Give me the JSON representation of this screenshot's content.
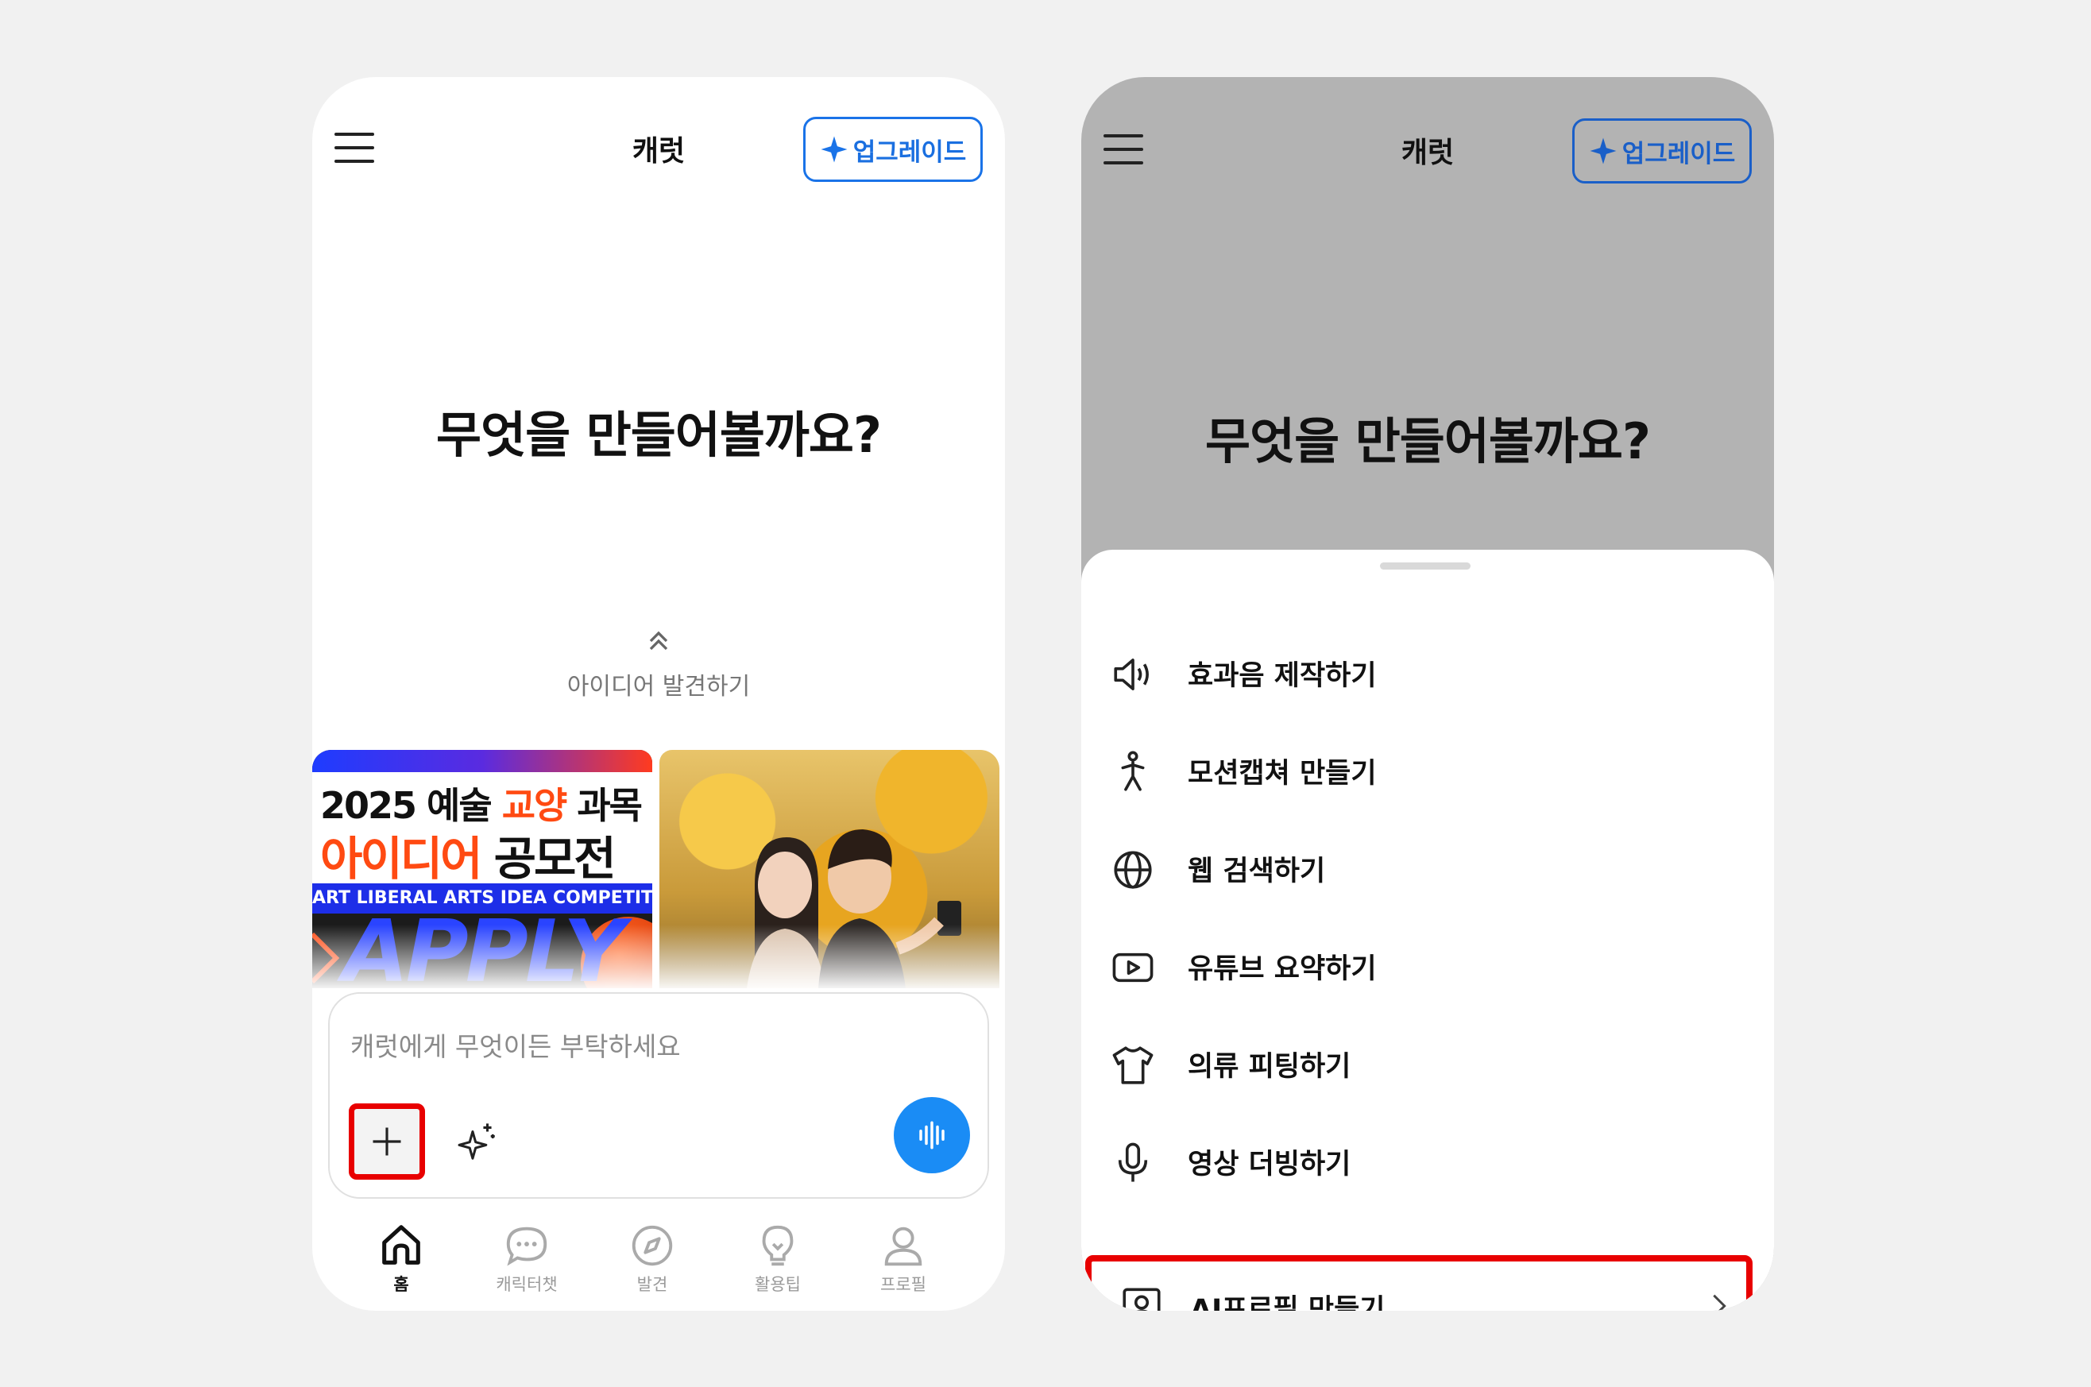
{
  "left_screen": {
    "app_title": "캐럿",
    "upgrade_label": "업그레이드",
    "headline": "무엇을 만들어볼까요?",
    "discover_label": "아이디어 발견하기",
    "banner": {
      "line1_a": "2025 예술 ",
      "line1_hl": "교양",
      "line1_b": " 과목",
      "line2_hl": "아이디어",
      "line2_b": " 공모전",
      "subtitle": "ART LIBERAL ARTS IDEA COMPETITION",
      "apply": "APPLY"
    },
    "composer_placeholder": "캐럿에게 무엇이든 부탁하세요",
    "tabs": [
      {
        "label": "홈",
        "icon": "home-icon"
      },
      {
        "label": "캐릭터챗",
        "icon": "chat-bubble-icon"
      },
      {
        "label": "발견",
        "icon": "compass-icon"
      },
      {
        "label": "활용팁",
        "icon": "lightbulb-icon"
      },
      {
        "label": "프로필",
        "icon": "person-icon"
      }
    ]
  },
  "right_screen": {
    "app_title": "캐럿",
    "upgrade_label": "업그레이드",
    "headline": "무엇을 만들어볼까요?",
    "menu_items": [
      {
        "label": "효과음 제작하기",
        "icon": "speaker-icon"
      },
      {
        "label": "모션캡쳐 만들기",
        "icon": "running-person-icon"
      },
      {
        "label": "웹 검색하기",
        "icon": "globe-icon"
      },
      {
        "label": "유튜브 요약하기",
        "icon": "youtube-icon"
      },
      {
        "label": "의류 피팅하기",
        "icon": "tshirt-icon"
      },
      {
        "label": "영상 더빙하기",
        "icon": "microphone-icon"
      },
      {
        "label": "AI프로필 만들기",
        "icon": "profile-portrait-icon"
      }
    ]
  },
  "colors": {
    "accent_blue": "#1a73e8",
    "highlight_red": "#e80000",
    "mic_button_blue": "#1a8cf5",
    "banner_orange": "#ff4a12",
    "dim_overlay": "#b3b3b3"
  }
}
